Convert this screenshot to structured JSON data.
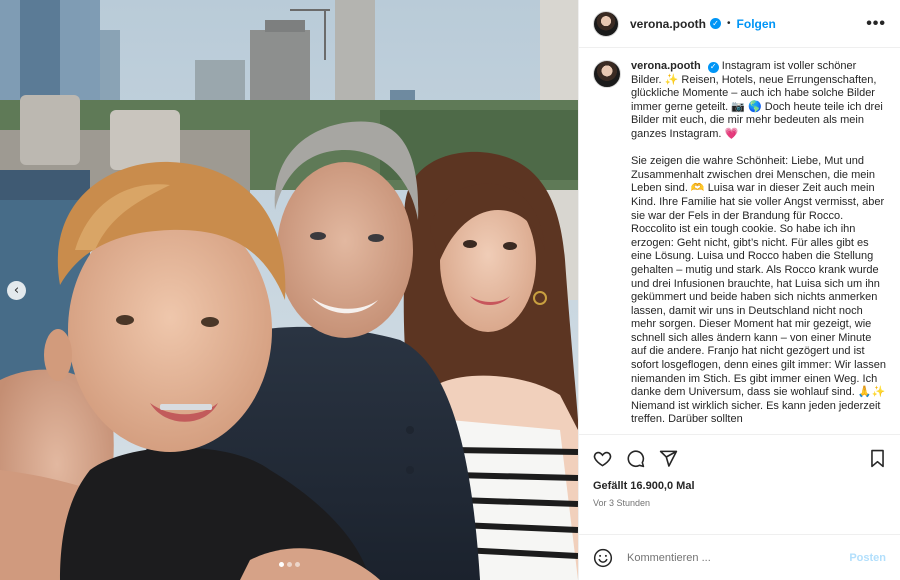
{
  "post": {
    "username": "verona.pooth",
    "verified_mark": "✓",
    "separator": "•",
    "follow_label": "Folgen",
    "more_label": "•••",
    "caption": "Instagram ist voller schöner Bilder. ✨ Reisen, Hotels, neue Errungenschaften, glückliche Momente – auch ich habe solche Bilder immer gerne geteilt. 📷 🌎 Doch heute teile ich drei Bilder mit euch, die mir mehr bedeuten als mein ganzes Instagram. 💗\n\nSie zeigen die wahre Schönheit: Liebe, Mut und Zusammenhalt zwischen drei Menschen, die mein Leben sind. 🫶 Luisa war in dieser Zeit auch mein Kind. Ihre Familie hat sie voller Angst vermisst, aber sie war der Fels in der Brandung für Rocco. Roccolito ist ein tough cookie. So habe ich ihn erzogen: Geht nicht, gibt’s nicht. Für alles gibt es eine Lösung. Luisa und Rocco haben die Stellung gehalten – mutig und stark. Als Rocco krank wurde und drei Infusionen brauchte, hat Luisa sich um ihn gekümmert und beide haben sich nichts anmerken lassen, damit wir uns in Deutschland nicht noch mehr sorgen. Dieser Moment hat mir gezeigt, wie schnell sich alles ändern kann – von einer Minute auf die andere. Franjo hat nicht gezögert und ist sofort losgeflogen, denn eines gilt immer: Wir lassen niemanden im Stich. Es gibt immer einen Weg. Ich danke dem Universum, dass sie wohlauf sind. 🙏✨ Niemand ist wirklich sicher. Es kann jeden jederzeit treffen. Darüber sollten",
    "likes": "Gefällt 16.900,0 Mal",
    "time_ago": "Vor 3 Stunden"
  },
  "icons": {
    "like": "heart-icon",
    "comment": "comment-icon",
    "share": "share-icon",
    "save": "bookmark-icon",
    "emoji": "emoji-icon",
    "prev": "chevron-left-icon",
    "prev_glyph": "‹"
  },
  "comment": {
    "placeholder": "Kommentieren ...",
    "post_label": "Posten"
  },
  "carousel": {
    "slide_count": 3,
    "active_index": 0
  },
  "colors": {
    "accent": "#0095f6",
    "post_disabled": "#b2dffc",
    "text": "#262626",
    "muted": "#737373"
  }
}
